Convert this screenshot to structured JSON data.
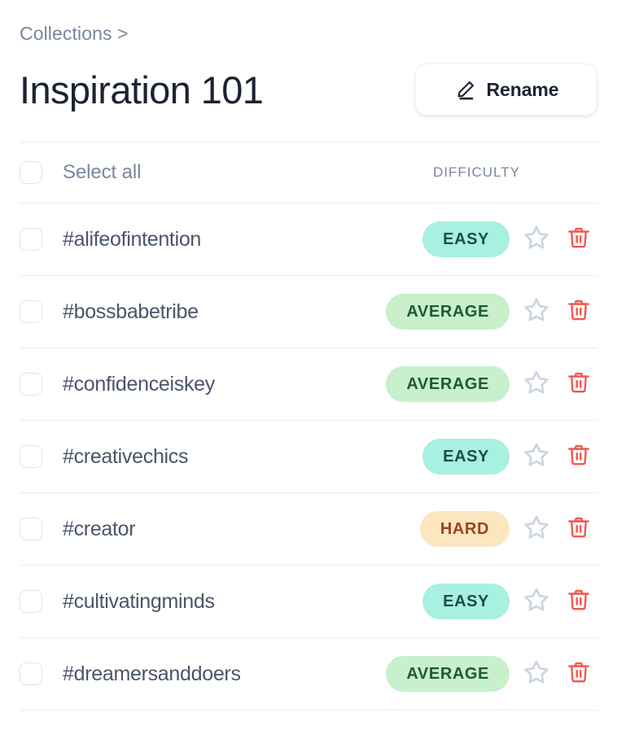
{
  "breadcrumb": {
    "text": "Collections >",
    "parent": "Collections"
  },
  "header": {
    "title": "Inspiration 101",
    "rename_button": {
      "label": "Rename",
      "icon": "pencil-icon"
    }
  },
  "list_header": {
    "select_all_label": "Select all",
    "difficulty_column_label": "DIFFICULTY"
  },
  "colors": {
    "easy_bg": "#a8f0e0",
    "easy_text": "#1d4d47",
    "average_bg": "#c7f0cb",
    "average_text": "#1e5b33",
    "hard_bg": "#fbe6c0",
    "hard_text": "#9c4420",
    "trash_icon": "#f4574f",
    "star_icon": "#ccd5e0",
    "title_text": "#1c2331",
    "tag_text": "#4a5568",
    "muted_text": "#7a869f",
    "divider": "#e9edf2",
    "checkbox_border": "#dfe5ee"
  },
  "rows": [
    {
      "tag": "#alifeofintention",
      "difficulty": "EASY",
      "difficulty_class": "easy",
      "star_icon": "star-icon",
      "delete_icon": "trash-icon",
      "checked": false
    },
    {
      "tag": "#bossbabetribe",
      "difficulty": "AVERAGE",
      "difficulty_class": "average",
      "star_icon": "star-icon",
      "delete_icon": "trash-icon",
      "checked": false
    },
    {
      "tag": "#confidenceiskey",
      "difficulty": "AVERAGE",
      "difficulty_class": "average",
      "star_icon": "star-icon",
      "delete_icon": "trash-icon",
      "checked": false
    },
    {
      "tag": "#creativechics",
      "difficulty": "EASY",
      "difficulty_class": "easy",
      "star_icon": "star-icon",
      "delete_icon": "trash-icon",
      "checked": false
    },
    {
      "tag": "#creator",
      "difficulty": "HARD",
      "difficulty_class": "hard",
      "star_icon": "star-icon",
      "delete_icon": "trash-icon",
      "checked": false
    },
    {
      "tag": "#cultivatingminds",
      "difficulty": "EASY",
      "difficulty_class": "easy",
      "star_icon": "star-icon",
      "delete_icon": "trash-icon",
      "checked": false
    },
    {
      "tag": "#dreamersanddoers",
      "difficulty": "AVERAGE",
      "difficulty_class": "average",
      "star_icon": "star-icon",
      "delete_icon": "trash-icon",
      "checked": false
    }
  ]
}
